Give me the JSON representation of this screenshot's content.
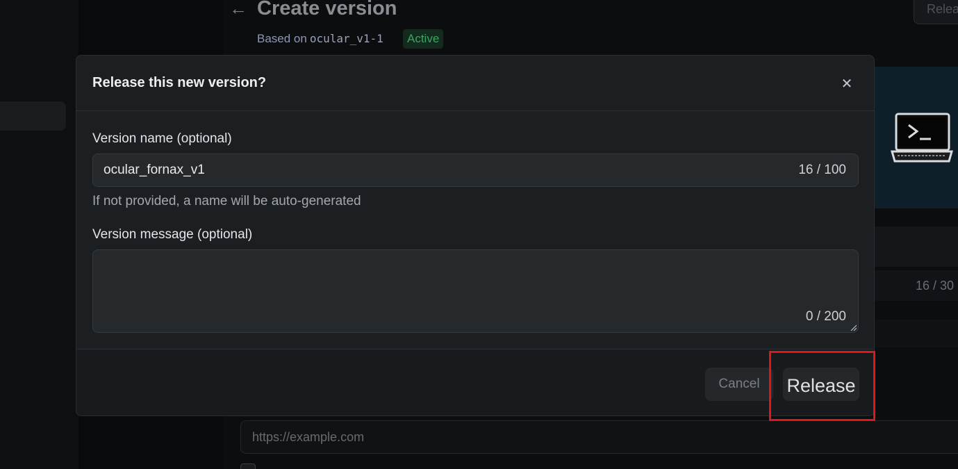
{
  "page": {
    "title": "Create version",
    "based_on_label": "Based on",
    "based_on_version": "ocular_v1-1",
    "status_badge": "Active",
    "release_button_partial": "Relea"
  },
  "background": {
    "url_placeholder": "https://example.com",
    "counter_partial": "16 / 30"
  },
  "dialog": {
    "title": "Release this new version?",
    "version_name": {
      "label": "Version name (optional)",
      "value": "ocular_fornax_v1",
      "counter": "16 / 100",
      "helper": "If not provided, a name will be auto-generated"
    },
    "version_message": {
      "label": "Version message (optional)",
      "value": "",
      "counter": "0 / 200"
    },
    "cancel_label": "Cancel",
    "release_label": "Release"
  },
  "colors": {
    "highlight": "#e0161b",
    "active_badge": "#3aa565",
    "modal_bg": "#1b1f22"
  }
}
